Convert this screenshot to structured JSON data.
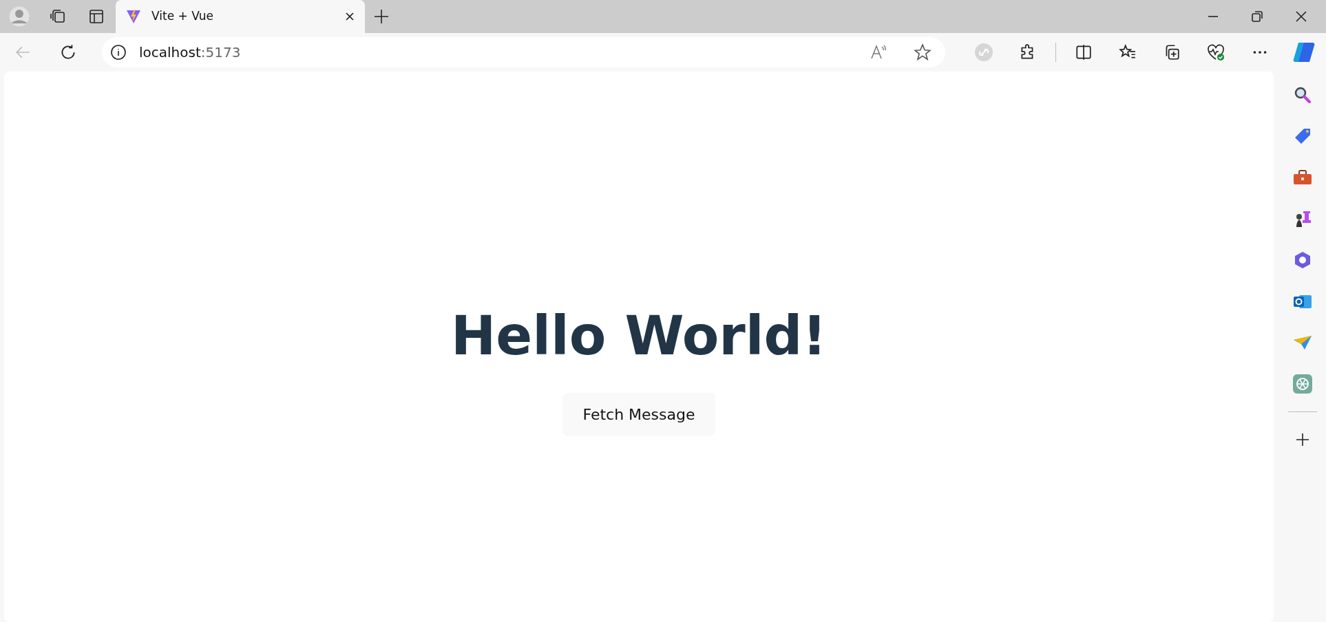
{
  "browser": {
    "tabs": [
      {
        "title": "Vite + Vue",
        "selected": true
      }
    ],
    "address": {
      "host": "localhost",
      "port": ":5173"
    }
  },
  "page": {
    "heading": "Hello World!",
    "button": "Fetch Message"
  }
}
